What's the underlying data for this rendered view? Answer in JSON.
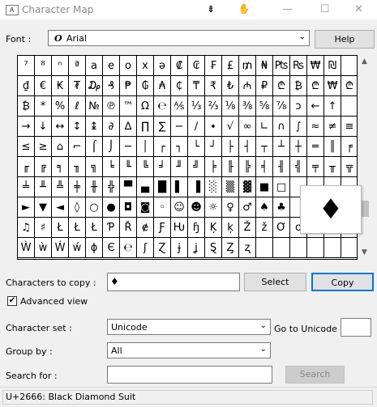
{
  "window": {
    "title": "Character Map",
    "minimize": "—",
    "maximize": "☐",
    "close": "✕"
  },
  "toolbar": {
    "icon1": "⇟",
    "icon2": "✋"
  },
  "font": {
    "label": "Font :",
    "icon": "O",
    "value": "Arial",
    "help_label": "Help"
  },
  "grid": {
    "rows": [
      [
        "⁷",
        "⁸",
        "ⁿ",
        "ª",
        "a",
        "e",
        "o",
        "x",
        "ə",
        "₡",
        "₢",
        "₣",
        "£",
        "₥",
        "₦",
        "₧",
        "₨",
        "₩",
        "₪",
        ""
      ],
      [
        "₫",
        "€",
        "₭",
        "₮",
        "₯",
        "₰",
        "₱",
        "₲",
        "₳",
        "₵",
        "₸",
        "₹",
        "₺",
        "₼",
        "₽",
        "₾",
        "₿",
        "₾",
        "₩",
        "₾"
      ],
      [
        "₿",
        "*",
        "%",
        "ℓ",
        "№",
        "℗",
        "™",
        "Ω",
        "℮",
        "⅍",
        "⅓",
        "⅔",
        "⅛",
        "⅜",
        "⅝",
        "⅞",
        "ↄ",
        "←",
        "↑",
        ""
      ],
      [
        "→",
        "↓",
        "↔",
        "↕",
        "↨",
        "∂",
        "∆",
        "∏",
        "∑",
        "−",
        "∕",
        "∙",
        "√",
        "∞",
        "∟",
        "∩",
        "∫",
        "≈",
        "≠",
        "≡"
      ],
      [
        "≤",
        "≥",
        "⌂",
        "⌐",
        "⌠",
        "⌡",
        "─",
        "│",
        "┌",
        "┐",
        "└",
        "┘",
        "├",
        "┤",
        "┬",
        "┴",
        "┼",
        "═",
        "║",
        "╒"
      ],
      [
        "╓",
        "╔",
        "╕",
        "╖",
        "╗",
        "╘",
        "╙",
        "╚",
        "╛",
        "╜",
        "╝",
        "╞",
        "╟",
        "╠",
        "╡",
        "╢",
        "╣",
        "╤",
        "╥",
        "╦"
      ],
      [
        "╧",
        "╨",
        "╩",
        "╪",
        "╫",
        "╬",
        "▀",
        "▄",
        "█",
        "▌",
        "▐",
        "░",
        "▒",
        "▓",
        "■",
        "□",
        "",
        "",
        "",
        ""
      ],
      [
        "►",
        "▼",
        "◄",
        "◊",
        "○",
        "●",
        "◘",
        "◙",
        "◦",
        "☺",
        "☻",
        "☼",
        "♀",
        "♂",
        "♠",
        "♣",
        "",
        "",
        "",
        ""
      ],
      [
        "♫",
        "♯",
        "Ł",
        "Ł",
        "Ł",
        "Ƥ",
        "Ř",
        "ɇ",
        "Ƒ",
        "Ƕ",
        "ɧ",
        "Ķ",
        "ķ",
        "Ž",
        "ž",
        "Ơ",
        "ơ",
        "",
        "",
        ""
      ],
      [
        "Ẁ",
        "ẁ",
        "Ẃ",
        "ẃ",
        "ɸ",
        "Є",
        "℮",
        "ʃ",
        "Ɀ",
        "ɉ",
        "ʝ",
        "Ȿ",
        "Ȥ",
        "ʐ",
        "",
        "",
        "",
        "",
        "",
        ""
      ]
    ],
    "zoom_char": "♦"
  },
  "copy": {
    "label": "Characters to copy :",
    "value": "♦",
    "select_label": "Select",
    "copy_label": "Copy"
  },
  "advanced": {
    "label": "Advanced view",
    "checked": "✔"
  },
  "charset": {
    "label": "Character set :",
    "value": "Unicode",
    "goto_label": "Go to Unicode :",
    "goto_value": ""
  },
  "groupby": {
    "label": "Group by :",
    "value": "All"
  },
  "search": {
    "label": "Search for :",
    "value": "",
    "button_label": "Search"
  },
  "status": {
    "text": "U+2666: Black Diamond Suit"
  }
}
